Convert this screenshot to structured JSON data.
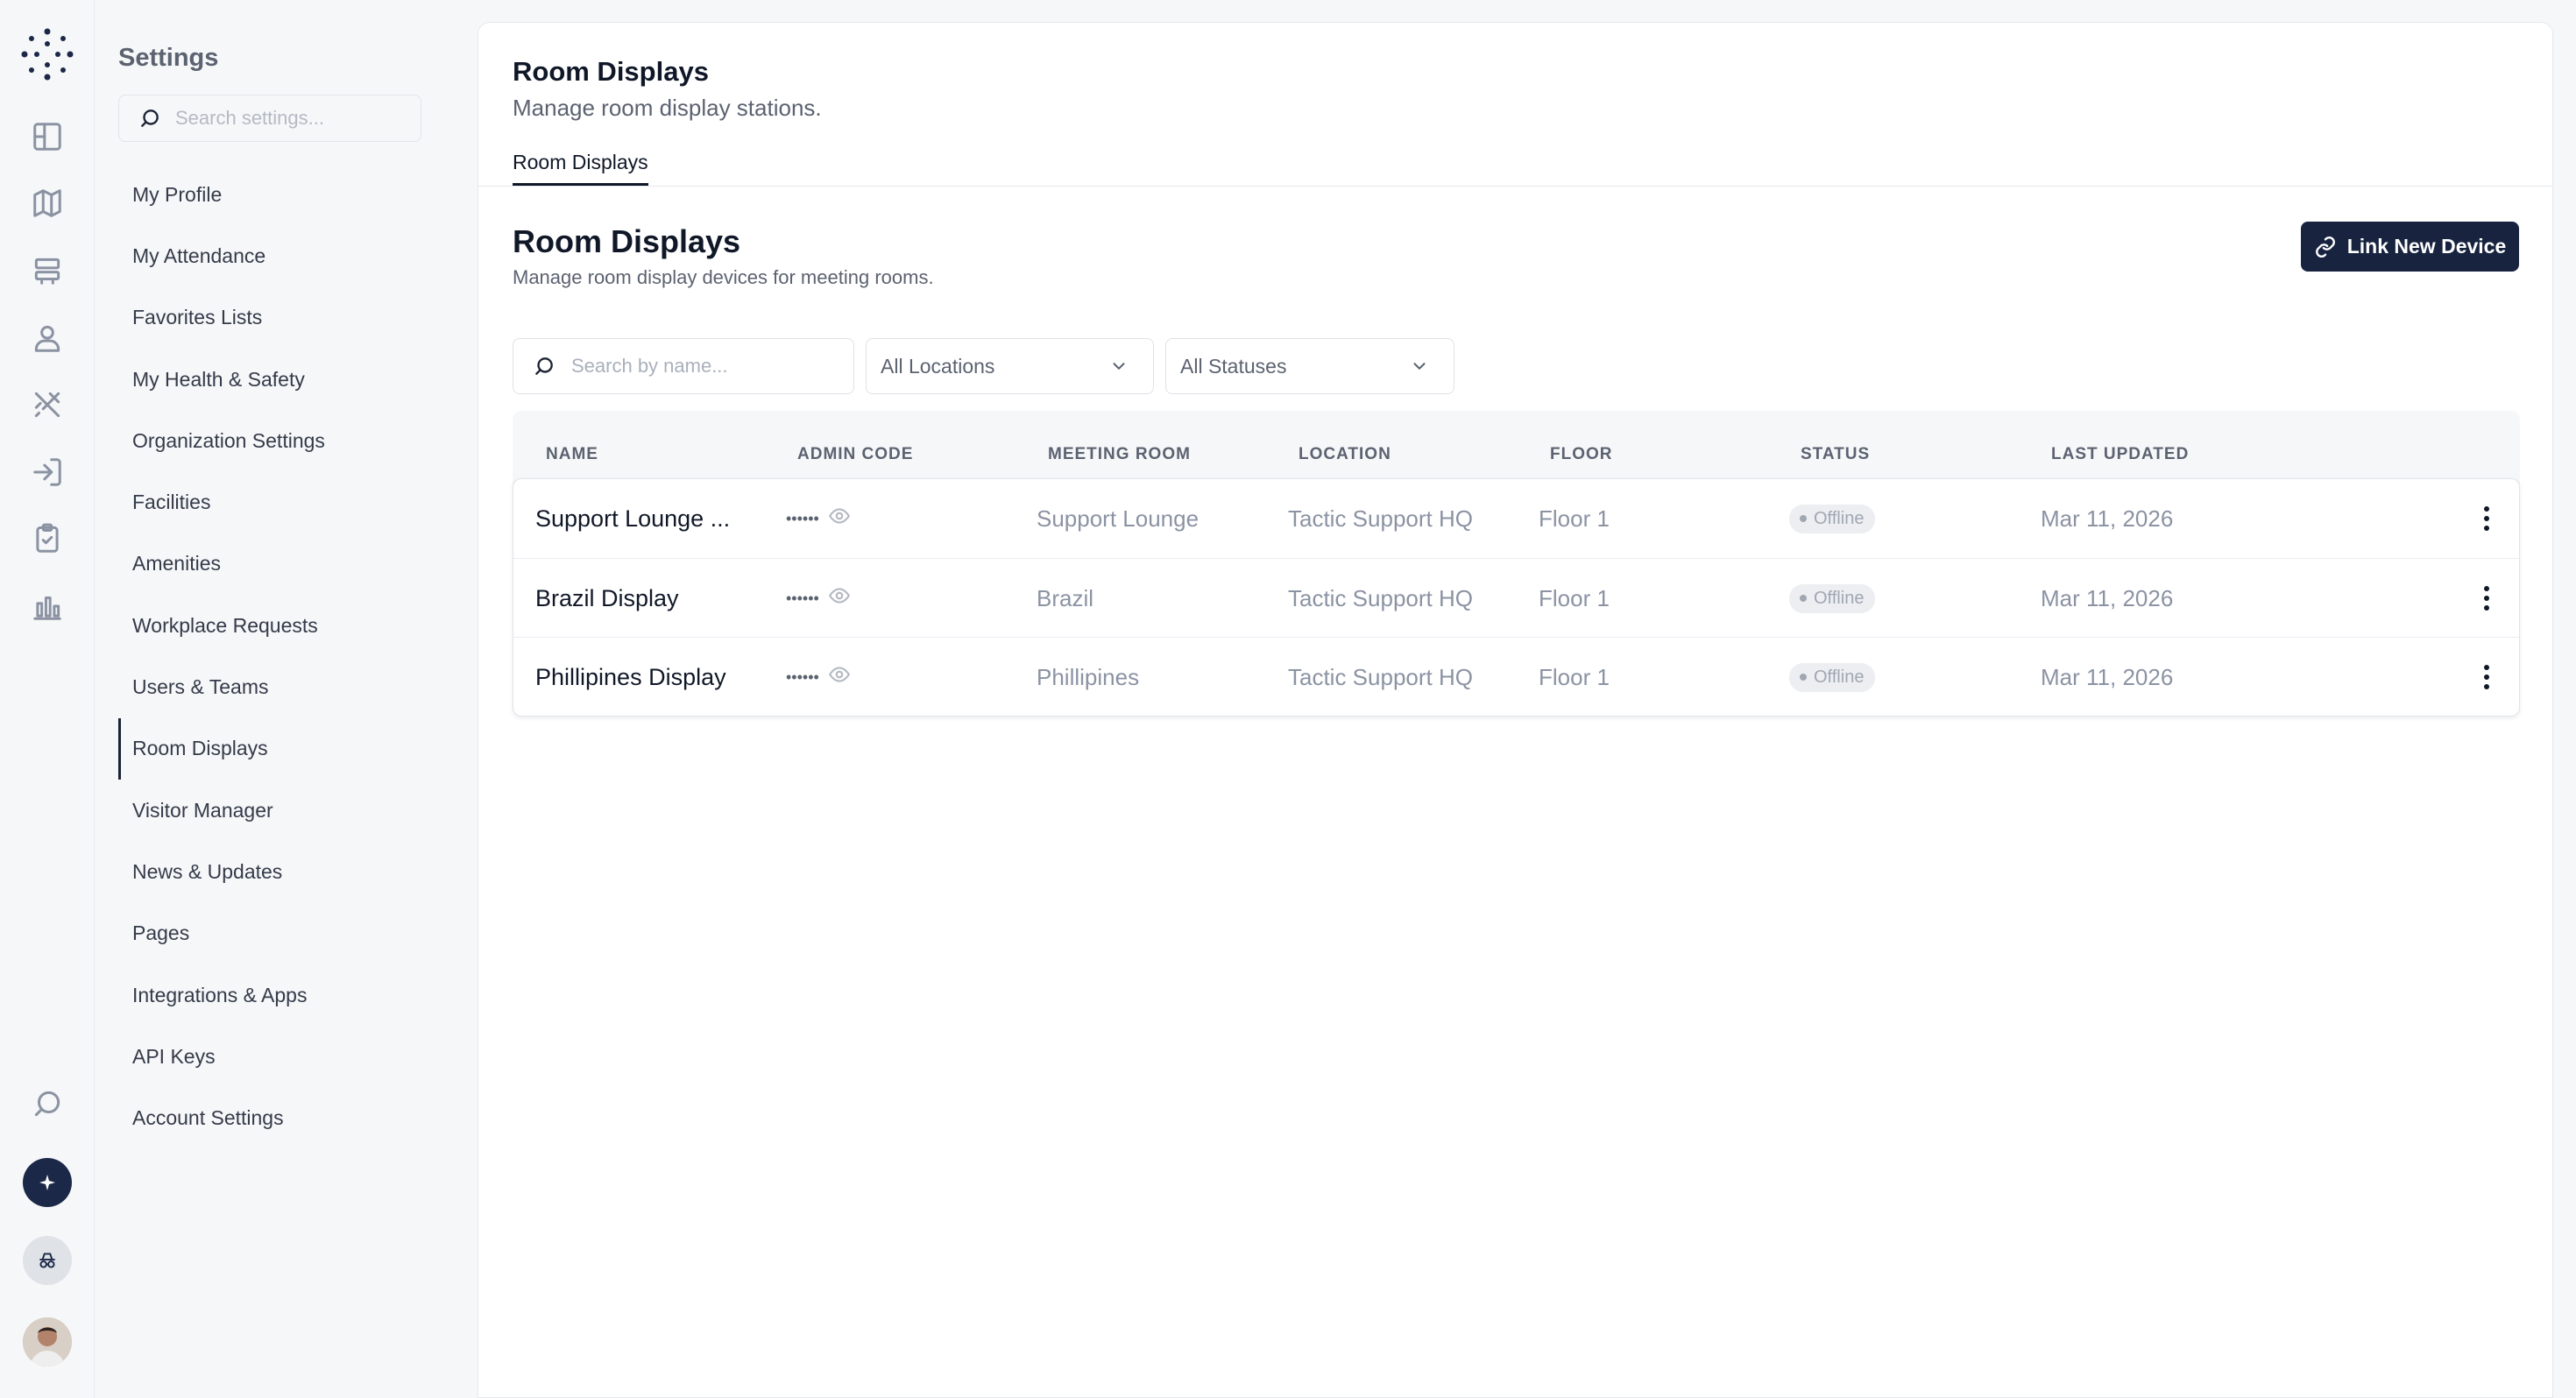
{
  "sidebar": {
    "title": "Settings",
    "search_placeholder": "Search settings...",
    "items": [
      {
        "label": "My Profile"
      },
      {
        "label": "My Attendance"
      },
      {
        "label": "Favorites Lists"
      },
      {
        "label": "My Health & Safety"
      },
      {
        "label": "Organization Settings"
      },
      {
        "label": "Facilities"
      },
      {
        "label": "Amenities"
      },
      {
        "label": "Workplace Requests"
      },
      {
        "label": "Users & Teams"
      },
      {
        "label": "Room Displays",
        "active": true
      },
      {
        "label": "Visitor Manager"
      },
      {
        "label": "News & Updates"
      },
      {
        "label": "Pages"
      },
      {
        "label": "Integrations & Apps"
      },
      {
        "label": "API Keys"
      },
      {
        "label": "Account Settings"
      }
    ]
  },
  "rail": {
    "icons": [
      "layout-icon",
      "map-icon",
      "desk-icon",
      "user-icon",
      "utensils-icon",
      "sign-in-icon",
      "clipboard-check-icon",
      "bar-chart-icon",
      "search-icon",
      "sparkle-icon",
      "incognito-icon",
      "avatar"
    ]
  },
  "header": {
    "title": "Room Displays",
    "subtitle": "Manage room display stations.",
    "tab": "Room Displays"
  },
  "section": {
    "title": "Room Displays",
    "subtitle": "Manage room display devices for meeting rooms.",
    "link_button": "Link New Device"
  },
  "filters": {
    "search_placeholder": "Search by name...",
    "location": "All Locations",
    "status": "All Statuses"
  },
  "table": {
    "columns": [
      "NAME",
      "ADMIN CODE",
      "MEETING ROOM",
      "LOCATION",
      "FLOOR",
      "STATUS",
      "LAST UPDATED"
    ],
    "rows": [
      {
        "name": "Support Lounge ...",
        "admin_code": "••••••",
        "meeting_room": "Support Lounge",
        "location": "Tactic Support HQ",
        "floor": "Floor 1",
        "status": "Offline",
        "updated": "Mar 11, 2026"
      },
      {
        "name": "Brazil Display",
        "admin_code": "••••••",
        "meeting_room": "Brazil",
        "location": "Tactic Support HQ",
        "floor": "Floor 1",
        "status": "Offline",
        "updated": "Mar 11, 2026"
      },
      {
        "name": "Phillipines Display",
        "admin_code": "••••••",
        "meeting_room": "Phillipines",
        "location": "Tactic Support HQ",
        "floor": "Floor 1",
        "status": "Offline",
        "updated": "Mar 11, 2026"
      }
    ]
  },
  "colors": {
    "primary": "#17233f",
    "background": "#f6f7f9",
    "badge_bg": "#eceef1"
  }
}
